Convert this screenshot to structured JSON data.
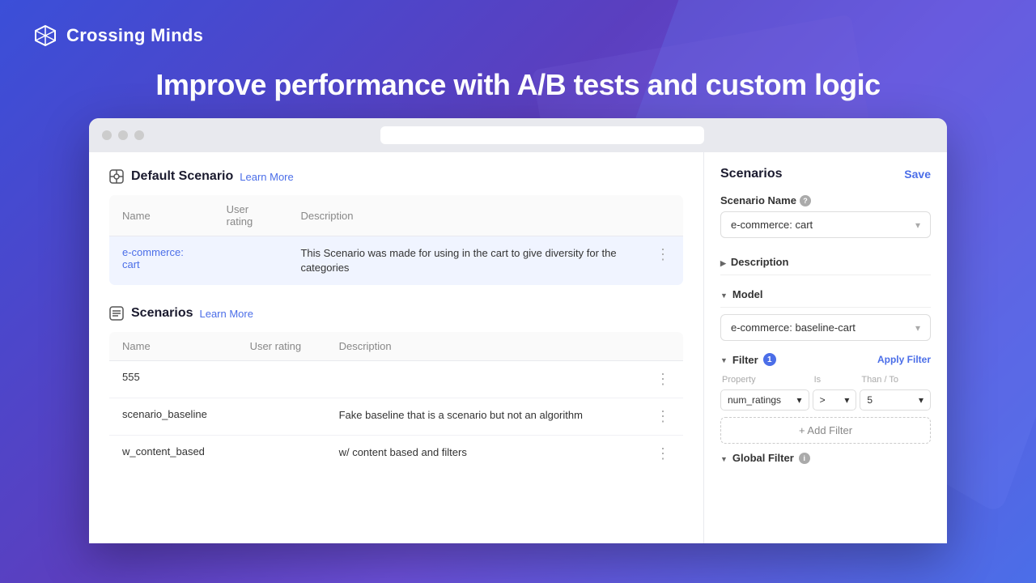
{
  "brand": {
    "name": "Crossing Minds",
    "logo_alt": "Crossing Minds logo"
  },
  "hero": {
    "title": "Improve performance with A/B tests and custom logic"
  },
  "browser": {
    "dots": [
      "dot1",
      "dot2",
      "dot3"
    ]
  },
  "default_scenario": {
    "section_title": "Default Scenario",
    "learn_more": "Learn More",
    "columns": {
      "name": "Name",
      "user_rating": "User rating",
      "description": "Description"
    },
    "rows": [
      {
        "name": "e-commerce: cart",
        "user_rating": "",
        "description": "This Scenario was made for using in the cart to give diversity for the categories"
      }
    ]
  },
  "scenarios": {
    "section_title": "Scenarios",
    "learn_more": "Learn More",
    "columns": {
      "name": "Name",
      "user_rating": "User rating",
      "description": "Description"
    },
    "rows": [
      {
        "name": "555",
        "description": ""
      },
      {
        "name": "scenario_baseline",
        "description": "Fake baseline that is a scenario but not an algorithm"
      },
      {
        "name": "w_content_based",
        "description": "w/ content based and filters"
      }
    ]
  },
  "right_panel": {
    "title": "Scenarios",
    "save_label": "Save",
    "scenario_name_label": "Scenario Name",
    "scenario_name_info": "?",
    "scenario_name_value": "e-commerce: cart",
    "description_label": "Description",
    "model_label": "Model",
    "model_value": "e-commerce: baseline-cart",
    "filter_label": "Filter",
    "filter_badge": "1",
    "apply_filter_label": "Apply Filter",
    "filter_columns": {
      "property": "Property",
      "is": "Is",
      "than_to": "Than / To"
    },
    "filter_row": {
      "property": "num_ratings",
      "is": ">",
      "than_to": "5"
    },
    "add_filter_label": "+ Add Filter",
    "global_filter_label": "Global Filter",
    "global_filter_info": "i"
  }
}
